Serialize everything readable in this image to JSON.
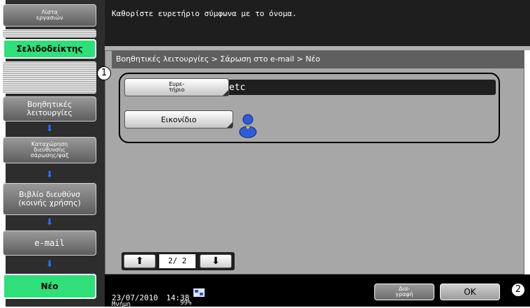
{
  "sidebar": {
    "job_list": "Λίστα\nεργασιών",
    "bookmark": "Σελιδοδείκτης",
    "utility": "Βοηθητικές\nλειτουργίες",
    "register_scan_address": "Καταχώρηση\nδιεύθυνσης\nσάρωσης/φαξ",
    "address_book": "Βιβλίο διευθύνσ\n(κοινής χρήσης)",
    "email": "e-mail",
    "new": "Νέο"
  },
  "message": "Καθορίστε ευρετήριο σύμφωνα με το όνομα.",
  "breadcrumb": "Βοηθητικές λειτουργίες > Σάρωση στο e-mail > Νέο",
  "fields": {
    "index_button": "Ευρε-\nτήριο",
    "index_value": "etc",
    "icon_button": "Εικονίδιο",
    "icon_image": "person-icon"
  },
  "pager": {
    "current": "2/ 2",
    "up_icon": "up-arrow-icon",
    "down_icon": "down-arrow-icon"
  },
  "status": {
    "date": "23/07/2010",
    "time": "14:38",
    "memory_label": "Μνήμη",
    "memory_value": "99%"
  },
  "buttons": {
    "delete": "Δια-\nγραφή",
    "ok": "OK"
  },
  "callouts": {
    "one": "1",
    "two": "2"
  },
  "colors": {
    "accent_green": "#2fe07a",
    "arrow_blue": "#2a6cf0"
  }
}
